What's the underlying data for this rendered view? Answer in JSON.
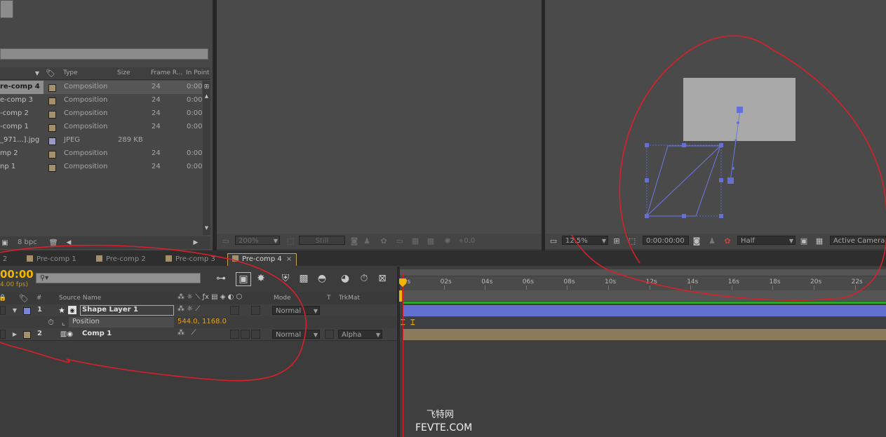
{
  "project": {
    "columns": {
      "type": "Type",
      "size": "Size",
      "frame_rate": "Frame R...",
      "in_point": "In Point"
    },
    "items": [
      {
        "name": "re-comp 4",
        "type": "Composition",
        "size": "",
        "frame": "24",
        "in": "0:00",
        "color": "#a3906d",
        "selected": true
      },
      {
        "name": "e-comp 3",
        "type": "Composition",
        "size": "",
        "frame": "24",
        "in": "0:00",
        "color": "#a3906d"
      },
      {
        "name": "-comp 2",
        "type": "Composition",
        "size": "",
        "frame": "24",
        "in": "0:00",
        "color": "#a3906d"
      },
      {
        "name": "-comp 1",
        "type": "Composition",
        "size": "",
        "frame": "24",
        "in": "0:00",
        "color": "#a3906d"
      },
      {
        "name": "_971...].jpg",
        "type": "JPEG",
        "size": "289 KB",
        "frame": "",
        "in": "",
        "color": "#9a9ac4"
      },
      {
        "name": "mp 2",
        "type": "Composition",
        "size": "",
        "frame": "24",
        "in": "0:00",
        "color": "#a3906d"
      },
      {
        "name": "np 1",
        "type": "Composition",
        "size": "",
        "frame": "24",
        "in": "0:00",
        "color": "#a3906d"
      }
    ],
    "bpc": "8 bpc"
  },
  "viewer_left": {
    "zoom": "200%",
    "still": "Still",
    "exposure": "+0.0"
  },
  "viewer_right": {
    "zoom": "12.5%",
    "timecode": "0:00:00:00",
    "resolution": "Half",
    "camera": "Active Camera"
  },
  "timeline": {
    "tabs": [
      "2",
      "Pre-comp 1",
      "Pre-comp 2",
      "Pre-comp 3",
      "Pre-comp 4"
    ],
    "active_tab": "Pre-comp 4",
    "timecode": "00:00",
    "fps": "4.00 fps)",
    "headers": {
      "num": "#",
      "source": "Source Name",
      "mode": "Mode",
      "t": "T",
      "trkmat": "TrkMat"
    },
    "layers": [
      {
        "num": "1",
        "name": "Shape Layer 1",
        "mode": "Normal",
        "trkmat": "",
        "label_color": "#7a85d8"
      },
      {
        "num": "2",
        "name": "Comp 1",
        "mode": "Normal",
        "trkmat": "Alpha",
        "label_color": "#a3906d"
      }
    ],
    "property": {
      "name": "Position",
      "value": "544.0, 1168.0"
    },
    "ruler": [
      "00s",
      "02s",
      "04s",
      "06s",
      "08s",
      "10s",
      "12s",
      "14s",
      "16s",
      "18s",
      "20s",
      "22s"
    ]
  },
  "watermark": {
    "line1": "飞特网",
    "line2": "FEVTE.COM"
  },
  "colors": {
    "accent": "#f2b600",
    "playhead": "#d9202a",
    "shape_bar": "#6470d0",
    "comp_bar": "#8c7a5c",
    "annotation": "#d9202a"
  }
}
